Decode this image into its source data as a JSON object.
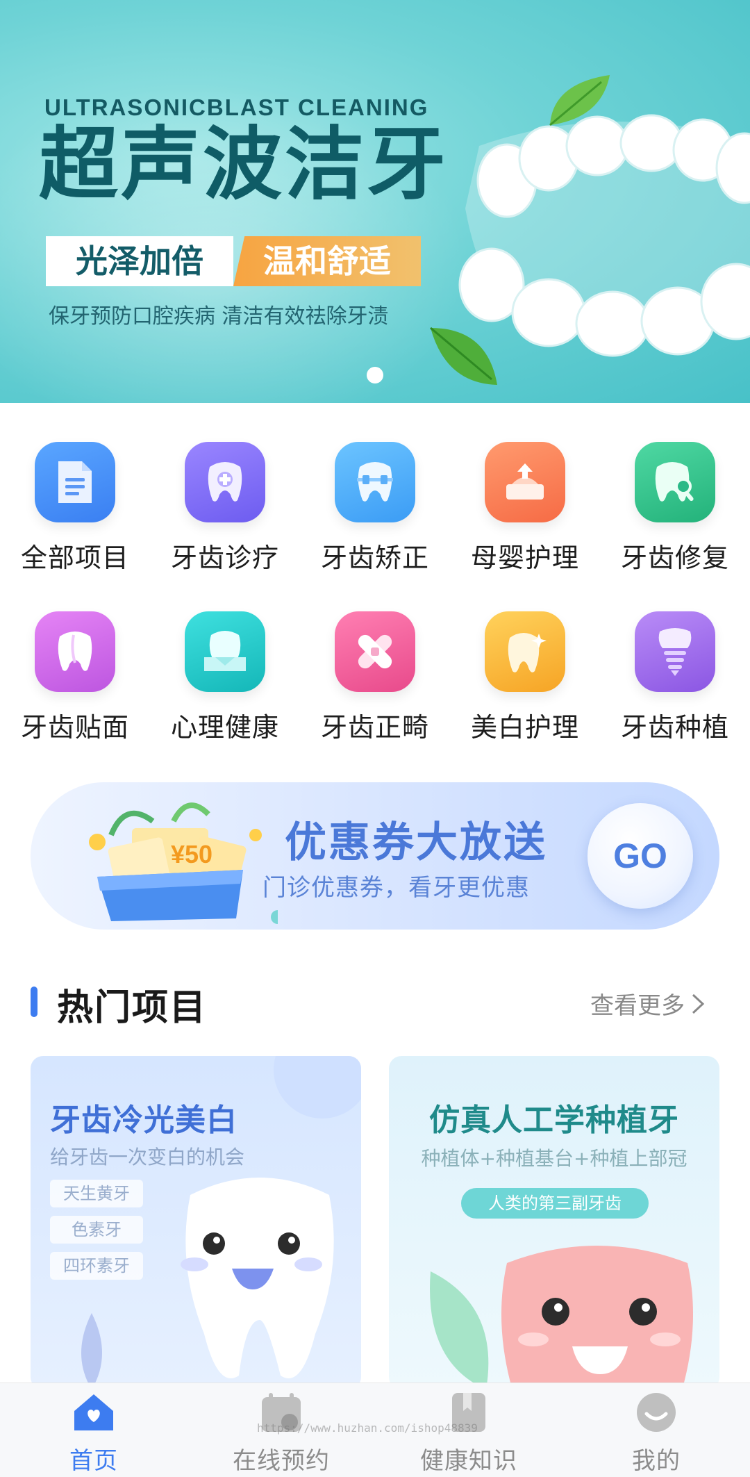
{
  "banner": {
    "english_title": "ULTRASONICBLAST CLEANING",
    "title": "超声波洁牙",
    "tag_left": "光泽加倍",
    "tag_right": "温和舒适",
    "subtitle": "保牙预防口腔疾病  清洁有效祛除牙渍"
  },
  "categories": [
    {
      "label": "全部项目",
      "icon": "document-icon",
      "color": "#3b86f5"
    },
    {
      "label": "牙齿诊疗",
      "icon": "tooth-plus-icon",
      "color": "#7d6cf3"
    },
    {
      "label": "牙齿矫正",
      "icon": "tooth-braces-icon",
      "color": "#3fa9f7"
    },
    {
      "label": "母婴护理",
      "icon": "baby-care-icon",
      "color": "#f7764e"
    },
    {
      "label": "牙齿修复",
      "icon": "tooth-search-icon",
      "color": "#2fc08a"
    },
    {
      "label": "牙齿贴面",
      "icon": "tooth-icon",
      "color": "#d36ee8"
    },
    {
      "label": "心理健康",
      "icon": "tooth-heart-icon",
      "color": "#22c9c8"
    },
    {
      "label": "牙齿正畸",
      "icon": "bandage-icon",
      "color": "#ee5d98"
    },
    {
      "label": "美白护理",
      "icon": "tooth-sparkle-icon",
      "color": "#f8b636"
    },
    {
      "label": "牙齿种植",
      "icon": "implant-icon",
      "color": "#9b66e8"
    }
  ],
  "coupon": {
    "title": "优惠券大放送",
    "description": "门诊优惠券，看牙更优惠",
    "go_label": "GO",
    "gift_amount": "¥50"
  },
  "hot_section": {
    "title": "热门项目",
    "more_label": "查看更多"
  },
  "cards": [
    {
      "title": "牙齿冷光美白",
      "subtitle": "给牙齿一次变白的机会",
      "tags": [
        "天生黄牙",
        "色素牙",
        "四环素牙"
      ]
    },
    {
      "title": "仿真人工学种植牙",
      "subtitle": "种植体+种植基台+种植上部冠",
      "badge": "人类的第三副牙齿"
    }
  ],
  "tabbar": [
    {
      "label": "首页",
      "icon": "home-icon",
      "active": true
    },
    {
      "label": "在线预约",
      "icon": "calendar-icon",
      "active": false
    },
    {
      "label": "健康知识",
      "icon": "bookmark-icon",
      "active": false
    },
    {
      "label": "我的",
      "icon": "profile-icon",
      "active": false
    }
  ],
  "watermark": "https://www.huzhan.com/ishop48839",
  "colors": {
    "accent": "#3d7cf0",
    "banner_teal": "#48c1c8",
    "title_dark": "#0f5c66"
  }
}
